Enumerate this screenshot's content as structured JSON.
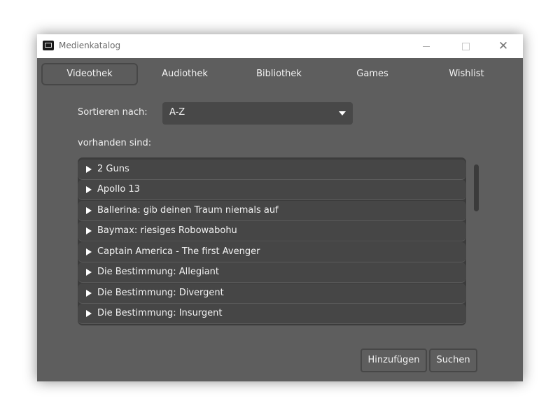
{
  "window": {
    "title": "Medienkatalog"
  },
  "tabs": [
    {
      "label": "Videothek",
      "active": true
    },
    {
      "label": "Audiothek",
      "active": false
    },
    {
      "label": "Bibliothek",
      "active": false
    },
    {
      "label": "Games",
      "active": false
    },
    {
      "label": "Wishlist",
      "active": false
    }
  ],
  "sort": {
    "label": "Sortieren nach:",
    "value": "A-Z"
  },
  "available_label": "vorhanden sind:",
  "items": [
    "2 Guns",
    "Apollo 13",
    "Ballerina: gib deinen Traum niemals auf",
    "Baymax: riesiges Robowabohu",
    "Captain America - The first Avenger",
    "Die Bestimmung: Allegiant",
    "Die Bestimmung: Divergent",
    "Die Bestimmung: Insurgent"
  ],
  "buttons": {
    "add": "Hinzufügen",
    "search": "Suchen"
  },
  "colors": {
    "window_bg": "#5e5e5e",
    "list_bg": "#3c3c3c",
    "item_bg": "#464646",
    "text": "#f2f2f2"
  },
  "icons": {
    "app": "media-catalog-icon",
    "expand": "triangle-right-icon",
    "dropdown": "caret-down-icon"
  }
}
